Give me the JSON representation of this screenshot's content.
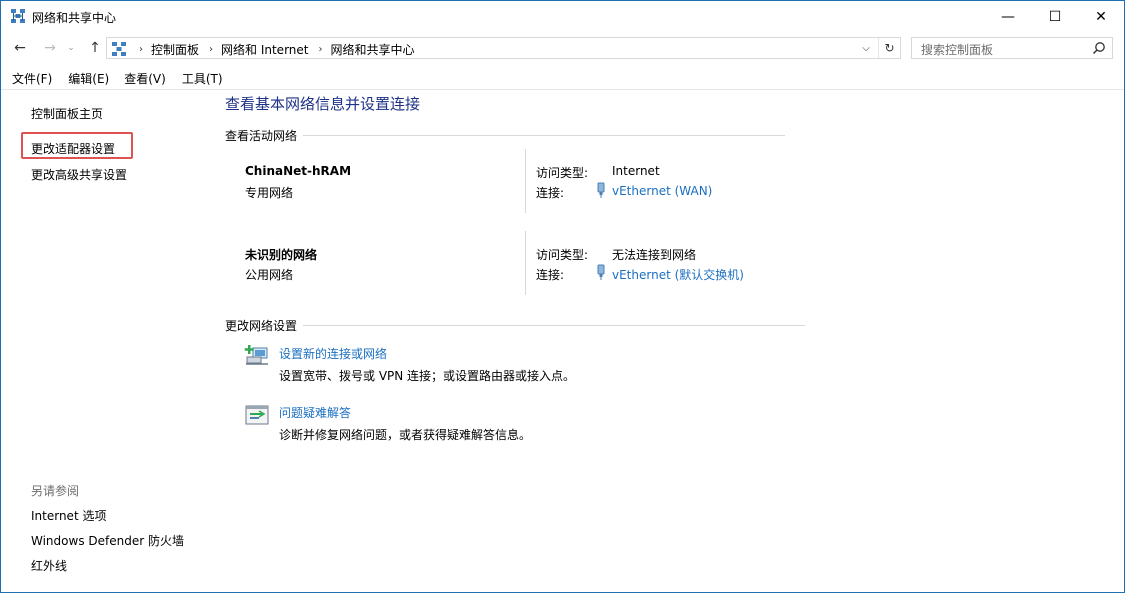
{
  "window": {
    "title": "网络和共享中心",
    "controls": {
      "minimize": "—",
      "maximize": "☐",
      "close": "✕"
    }
  },
  "nav": {
    "back": "←",
    "forward": "→",
    "recent": "⌄",
    "up": "↑",
    "breadcrumbs": [
      "控制面板",
      "网络和 Internet",
      "网络和共享中心"
    ],
    "separator": "›",
    "dropdown": "⌵",
    "refresh": "↻",
    "search_placeholder": "搜索控制面板"
  },
  "menu": [
    "文件(F)",
    "编辑(E)",
    "查看(V)",
    "工具(T)"
  ],
  "left_pane": {
    "home": "控制面板主页",
    "adapter_settings": "更改适配器设置",
    "advanced_sharing": "更改高级共享设置",
    "see_also_heading": "另请参阅",
    "see_also": [
      "Internet 选项",
      "Windows Defender 防火墙",
      "红外线"
    ]
  },
  "main": {
    "title": "查看基本网络信息并设置连接",
    "active_networks_heading": "查看活动网络",
    "access_type_label": "访问类型:",
    "connection_label": "连接:",
    "networks": [
      {
        "name": "ChinaNet-hRAM",
        "category": "专用网络",
        "access_type": "Internet",
        "connection": "vEthernet (WAN)"
      },
      {
        "name": "未识别的网络",
        "category": "公用网络",
        "access_type": "无法连接到网络",
        "connection": "vEthernet (默认交换机)"
      }
    ],
    "change_settings_heading": "更改网络设置",
    "tasks": [
      {
        "icon": "new-connection-icon",
        "link": "设置新的连接或网络",
        "description": "设置宽带、拨号或 VPN 连接；或设置路由器或接入点。"
      },
      {
        "icon": "troubleshoot-icon",
        "link": "问题疑难解答",
        "description": "诊断并修复网络问题，或者获得疑难解答信息。"
      }
    ]
  },
  "colors": {
    "link": "#1a6fc2",
    "title": "#1e3287",
    "highlight": "#e05151",
    "border": "#1f6fb5"
  }
}
